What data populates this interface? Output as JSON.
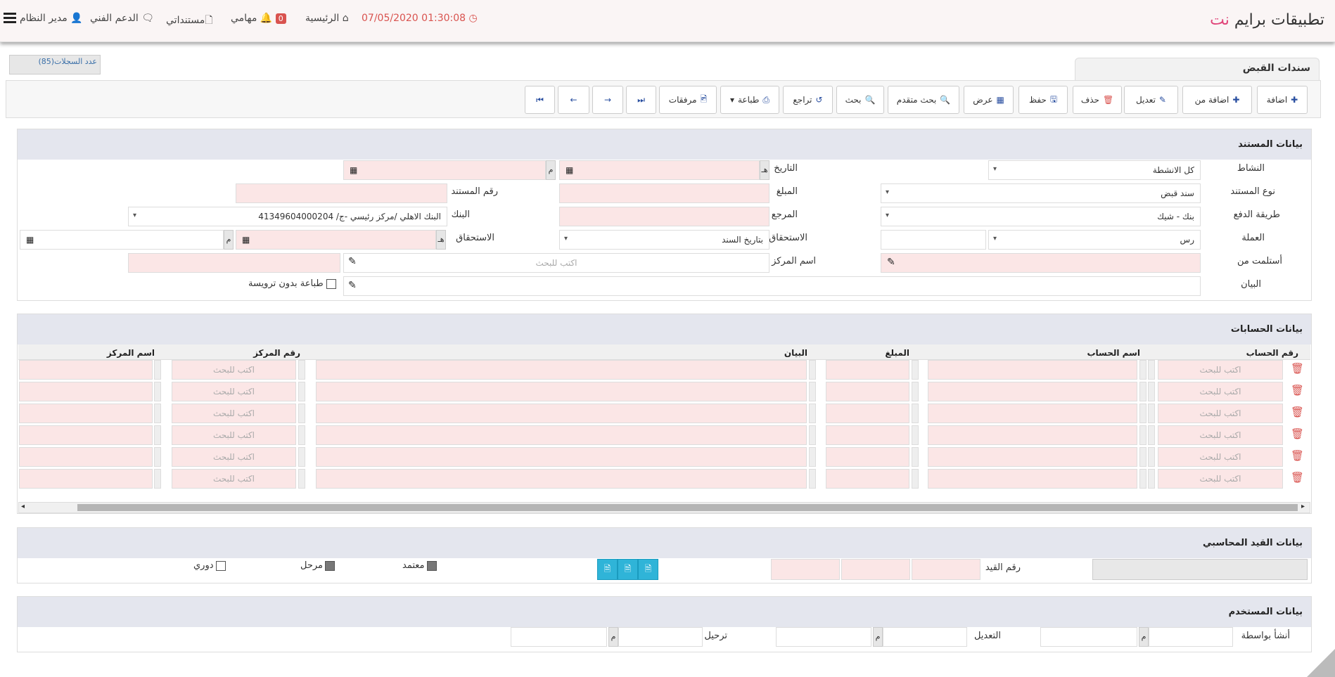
{
  "header": {
    "brand_main": "تطبيقات برايم ",
    "brand_accent": "نت",
    "admin": "مدير النظام",
    "support": "الدعم الفني",
    "documents": "مستنداتي",
    "tasks": "مهامي",
    "tasks_count": "0",
    "home": "الرئيسية",
    "datetime": "01:30:08 07/05/2020"
  },
  "records": "عدد السجلات(85)",
  "tab_title": "سندات القبض",
  "toolbar": {
    "add": "اضافة",
    "add_from": "اضافة من",
    "edit": "تعديل",
    "delete": "حذف",
    "save": "حفظ",
    "view": "عرض",
    "adv_search": "بحث متقدم",
    "search": "بحث",
    "undo": "تراجع",
    "print": "طباعة",
    "attachments": "مرفقات"
  },
  "doc": {
    "title": "بيانات المستند",
    "activity_lbl": "النشاط",
    "activity_val": "كل الانشطة",
    "date_lbl": "التاريخ",
    "hijri": "هـ",
    "greg": "م",
    "doc_type_lbl": "نوع المستند",
    "doc_type_val": "سند قبض",
    "amount_lbl": "المبلغ",
    "doc_no_lbl": "رقم المستند",
    "pay_lbl": "طريقة الدفع",
    "pay_val": "بنك - شيك",
    "ref_lbl": "المرجع",
    "bank_lbl": "البنك",
    "bank_val": "البنك الاهلي /مركز رئيسي -ج/ 41349604000204",
    "currency_lbl": "العملة",
    "currency_val": "رس",
    "due_lbl": "الاستحقاق",
    "due_val": "بتاريخ السند",
    "due2_lbl": "الاستحقاق",
    "received_lbl": "أستلمت من",
    "center_lbl": "اسم المركز",
    "search_ph": "اكتب للبحث",
    "desc_lbl": "البيان",
    "print_noheader": "طباعة بدون ترويسة"
  },
  "acc": {
    "title": "بيانات الحسابات",
    "col_no": "رقم الحساب",
    "col_name": "اسم الحساب",
    "col_amount": "المبلغ",
    "col_desc": "البيان",
    "col_center_no": "رقم المركز",
    "col_center_name": "اسم المركز",
    "ph": "اكتب للبحث"
  },
  "journal": {
    "title": "بيانات القيد المحاسبي",
    "entry_no": "رقم القيد",
    "approved": "معتمد",
    "posted": "مرحل",
    "periodic": "دوري"
  },
  "user": {
    "title": "بيانات المستخدم",
    "created_by": "أنشأ بواسطة",
    "modified": "التعديل",
    "posting": "ترحيل",
    "greg": "م"
  }
}
